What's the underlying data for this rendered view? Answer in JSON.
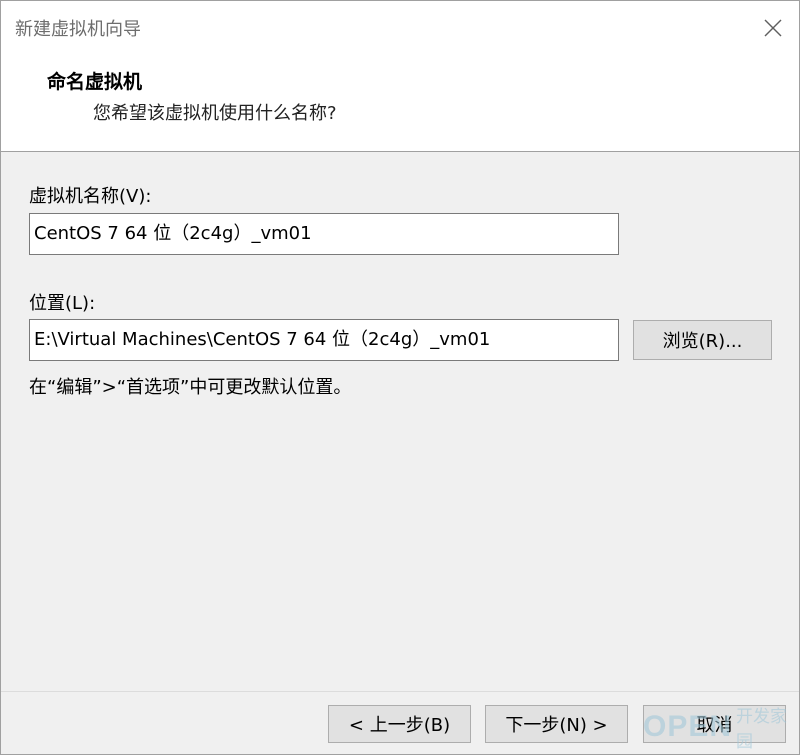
{
  "window": {
    "title": "新建虚拟机向导",
    "close_icon": "close-icon"
  },
  "header": {
    "title": "命名虚拟机",
    "subtitle": "您希望该虚拟机使用什么名称?"
  },
  "form": {
    "name_label": "虚拟机名称(V):",
    "name_value": "CentOS 7 64 位（2c4g）_vm01",
    "location_label": "位置(L):",
    "location_value": "E:\\Virtual Machines\\CentOS 7 64 位（2c4g）_vm01",
    "browse_label": "浏览(R)...",
    "hint": "在“编辑”>“首选项”中可更改默认位置。"
  },
  "footer": {
    "back_label": "< 上一步(B)",
    "next_label": "下一步(N) >",
    "cancel_label": "取消"
  },
  "watermark": {
    "logo": "OPEN",
    "text": "开发家园"
  }
}
